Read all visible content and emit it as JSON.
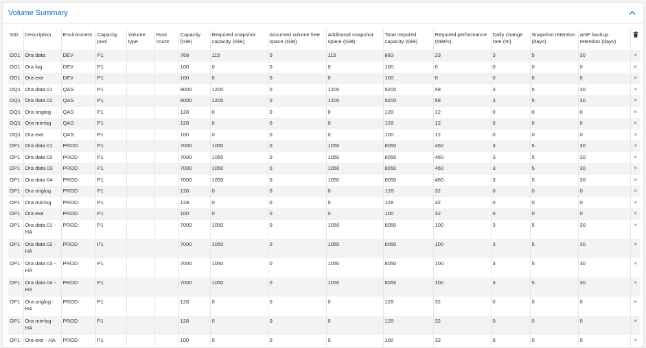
{
  "header": {
    "title": "Volume Summary"
  },
  "columns": [
    "SID",
    "Description",
    "Environment",
    "Capacity pool",
    "Volume type",
    "Host count",
    "Capacity (GiB)",
    "Required snapshot capacity (GiB)",
    "Assumed volume free space (GiB)",
    "Additional snapshot space (GiB)",
    "Total required capacity (GiB)",
    "Required performance (MiB/s)",
    "Daily change rate (%)",
    "Snapshot retention (days)",
    "ANF backup retention (days)"
  ],
  "delete_glyph": "×",
  "rows": [
    [
      "OD1",
      "Ora data",
      "DEV",
      "P1",
      "",
      "",
      "768",
      "115",
      "0",
      "115",
      "883",
      "23",
      "3",
      "5",
      "30"
    ],
    [
      "OD1",
      "Ora log",
      "DEV",
      "P1",
      "",
      "",
      "100",
      "0",
      "0",
      "0",
      "100",
      "6",
      "0",
      "0",
      "0"
    ],
    [
      "OD1",
      "Ora exe",
      "DEV",
      "P1",
      "",
      "",
      "100",
      "0",
      "0",
      "0",
      "100",
      "6",
      "0",
      "0",
      "0"
    ],
    [
      "OQ1",
      "Ora data 01",
      "QAS",
      "P1",
      "",
      "",
      "8000",
      "1200",
      "0",
      "1200",
      "9200",
      "58",
      "3",
      "5",
      "30"
    ],
    [
      "OQ1",
      "Ora data 02",
      "QAS",
      "P1",
      "",
      "",
      "8000",
      "1200",
      "0",
      "1200",
      "9200",
      "58",
      "3",
      "5",
      "30"
    ],
    [
      "OQ1",
      "Ora origlog",
      "QAS",
      "P1",
      "",
      "",
      "128",
      "0",
      "0",
      "0",
      "128",
      "12",
      "0",
      "0",
      "0"
    ],
    [
      "OQ1",
      "Ora mirrlog",
      "QAS",
      "P1",
      "",
      "",
      "128",
      "0",
      "0",
      "0",
      "128",
      "12",
      "0",
      "0",
      "0"
    ],
    [
      "OQ1",
      "Ora exe",
      "QAS",
      "P1",
      "",
      "",
      "100",
      "0",
      "0",
      "0",
      "100",
      "12",
      "0",
      "0",
      "0"
    ],
    [
      "OP1",
      "Ora data 01",
      "PROD",
      "P1",
      "",
      "",
      "7000",
      "1050",
      "0",
      "1050",
      "8050",
      "460",
      "3",
      "5",
      "30"
    ],
    [
      "OP1",
      "Ora data 02",
      "PROD",
      "P1",
      "",
      "",
      "7000",
      "1050",
      "0",
      "1050",
      "8050",
      "460",
      "3",
      "5",
      "30"
    ],
    [
      "OP1",
      "Ora data 03",
      "PROD",
      "P1",
      "",
      "",
      "7000",
      "1050",
      "0",
      "1050",
      "8050",
      "460",
      "3",
      "5",
      "30"
    ],
    [
      "OP1",
      "Ora data 04",
      "PROD",
      "P1",
      "",
      "",
      "7000",
      "1050",
      "0",
      "1050",
      "8050",
      "460",
      "3",
      "5",
      "30"
    ],
    [
      "OP1",
      "Ora origlog",
      "PROD",
      "P1",
      "",
      "",
      "128",
      "0",
      "0",
      "0",
      "128",
      "32",
      "0",
      "0",
      "0"
    ],
    [
      "OP1",
      "Ora mirrlog",
      "PROD",
      "P1",
      "",
      "",
      "128",
      "0",
      "0",
      "0",
      "128",
      "32",
      "0",
      "0",
      "0"
    ],
    [
      "OP1",
      "Ora exe",
      "PROD",
      "P1",
      "",
      "",
      "100",
      "0",
      "0",
      "0",
      "100",
      "32",
      "0",
      "0",
      "0"
    ],
    [
      "OP1",
      "Ora data 01 - HA",
      "PROD",
      "P1",
      "",
      "",
      "7000",
      "1050",
      "0",
      "1050",
      "8050",
      "100",
      "3",
      "5",
      "30"
    ],
    [
      "OP1",
      "Ora data 02 - HA",
      "PROD",
      "P1",
      "",
      "",
      "7000",
      "1050",
      "0",
      "1050",
      "8050",
      "100",
      "3",
      "5",
      "30"
    ],
    [
      "OP1",
      "Ora data 03 - HA",
      "PROD",
      "P1",
      "",
      "",
      "7000",
      "1050",
      "0",
      "1050",
      "8050",
      "100",
      "3",
      "5",
      "30"
    ],
    [
      "OP1",
      "Ora data 04 - HA",
      "PROD",
      "P1",
      "",
      "",
      "7000",
      "1050",
      "0",
      "1050",
      "8050",
      "100",
      "3",
      "5",
      "30"
    ],
    [
      "OP1",
      "Ora origlog - HA",
      "PROD",
      "P1",
      "",
      "",
      "128",
      "0",
      "0",
      "0",
      "128",
      "32",
      "0",
      "0",
      "0"
    ],
    [
      "OP1",
      "Ora mirrlog - HA",
      "PROD",
      "P1",
      "",
      "",
      "128",
      "0",
      "0",
      "0",
      "128",
      "32",
      "0",
      "0",
      "0"
    ],
    [
      "OP1",
      "Ora exe - HA",
      "PROD",
      "P1",
      "",
      "",
      "100",
      "0",
      "0",
      "0",
      "100",
      "32",
      "0",
      "0",
      "0"
    ]
  ]
}
